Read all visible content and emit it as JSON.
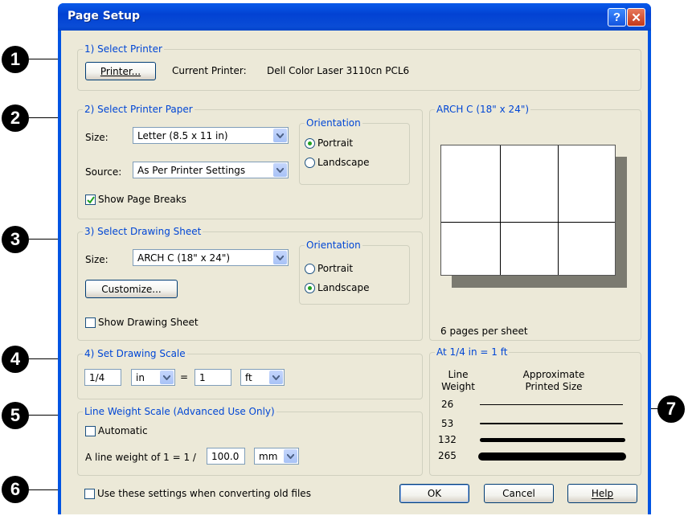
{
  "window": {
    "title": "Page Setup",
    "help_glyph": "?",
    "close_glyph": "✕"
  },
  "callouts": [
    "1",
    "2",
    "3",
    "4",
    "5",
    "6",
    "7"
  ],
  "printer": {
    "group_title": "1) Select Printer",
    "button_label": "Printer...",
    "current_label": "Current Printer:",
    "current_value": "Dell Color Laser 3110cn PCL6"
  },
  "paper": {
    "group_title": "2) Select Printer Paper",
    "size_label": "Size:",
    "size_value": "Letter (8.5 x 11 in)",
    "source_label": "Source:",
    "source_value": "As Per Printer Settings",
    "show_breaks_label": "Show Page Breaks",
    "show_breaks_checked": true,
    "orientation_title": "Orientation",
    "portrait_label": "Portrait",
    "landscape_label": "Landscape",
    "orientation_selected": "Portrait"
  },
  "drawing_sheet": {
    "group_title": "3) Select Drawing Sheet",
    "size_label": "Size:",
    "size_value": "ARCH C  (18\" x 24\")",
    "customize_label": "Customize...",
    "show_sheet_label": "Show Drawing Sheet",
    "show_sheet_checked": false,
    "orientation_title": "Orientation",
    "portrait_label": "Portrait",
    "landscape_label": "Landscape",
    "orientation_selected": "Landscape"
  },
  "scale": {
    "group_title": "4) Set Drawing Scale",
    "value1": "1/4",
    "unit1": "in",
    "equals": "=",
    "value2": "1",
    "unit2": "ft"
  },
  "line_weight": {
    "group_title": "Line Weight Scale (Advanced Use Only)",
    "automatic_label": "Automatic",
    "automatic_checked": false,
    "prefix_label": "A line weight of 1 = 1 /",
    "value": "100.0",
    "unit": "mm"
  },
  "preview": {
    "group_title": "ARCH C  (18\" x 24\")",
    "pages_text": "6 pages per sheet"
  },
  "weights": {
    "group_title": "At 1/4 in = 1 ft",
    "col1_header": "Line Weight",
    "col2_header": "Approximate Printed Size",
    "rows": [
      {
        "weight": "26",
        "thickness": 1
      },
      {
        "weight": "53",
        "thickness": 2
      },
      {
        "weight": "132",
        "thickness": 5
      },
      {
        "weight": "265",
        "thickness": 9
      }
    ]
  },
  "footer": {
    "convert_label": "Use these settings when converting old files",
    "convert_checked": false,
    "ok_label": "OK",
    "cancel_label": "Cancel",
    "help_label": "Help"
  },
  "colors": {
    "titlebar": "#0054e3",
    "group_title": "#0046d5",
    "client_bg": "#ece9d8"
  }
}
